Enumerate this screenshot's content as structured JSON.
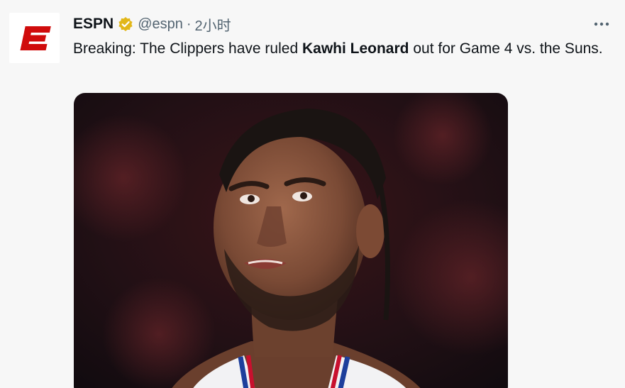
{
  "tweet": {
    "author_name": "ESPN",
    "handle": "@espn",
    "separator": "·",
    "time": "2小时",
    "text_before": "Breaking: The Clippers have ruled ",
    "text_bold": "Kawhi Leonard",
    "text_after": " out for Game 4 vs. the Suns.",
    "avatar_icon": "espn-logo-icon",
    "verified_icon": "verified-badge-icon",
    "more_icon": "more-horizontal-icon",
    "media_icon": "player-photo",
    "colors": {
      "espn_red": "#d00c0c",
      "verified_gold": "#e2b719",
      "text": "#0f1419",
      "muted": "#536471"
    }
  }
}
